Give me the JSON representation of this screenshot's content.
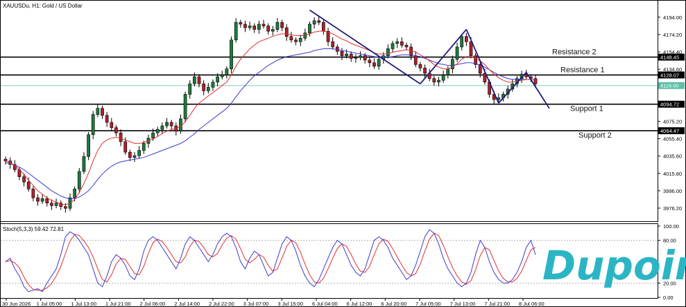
{
  "chart_data": {
    "type": "candlestick",
    "header": "XAUUSDu, H1:  Gold / US Dollar",
    "oscillator_label": "Stoch(5,3,3) 59.42 72.81",
    "price_ticks": [
      "4194.00",
      "4174.20",
      "4154.40",
      "4134.60",
      "4115.00",
      "4094.80",
      "4075.20",
      "4055.40",
      "4035.60",
      "4015.80",
      "3996.00",
      "3976.20"
    ],
    "stoch_ticks": [
      "100.00",
      "80.00",
      "20.00",
      "0.00"
    ],
    "time_labels": [
      "30 Jun 2026",
      "1 Jul 05:00",
      "1 Jul 13:00",
      "1 Jul 21:00",
      "2 Jul 06:00",
      "2 Jul 14:00",
      "2 Jul 22:00",
      "3 Jul 07:00",
      "3 Jul 15:00",
      "6 Jul 04:00",
      "6 Jul 12:00",
      "6 Jul 20:00",
      "7 Jul 05:00",
      "7 Jul 13:00",
      "7 Jul 21:00",
      "8 Jul 06:00"
    ],
    "levels": [
      {
        "name": "Resistance 2",
        "value": 4148.45,
        "tag": "4148.45"
      },
      {
        "name": "Resistance 1",
        "value": 4128.07,
        "tag": "4128.07"
      },
      {
        "name": "Support 1",
        "value": 4094.72,
        "tag": "4094.72"
      },
      {
        "name": "Support 2",
        "value": 4064.47,
        "tag": "4064.47"
      }
    ],
    "current_price": {
      "value": 4116.0,
      "tag": "4116.00"
    },
    "ylim": [
      3962,
      4212
    ],
    "stoch_ylim": [
      0,
      100
    ],
    "closes": [
      4030,
      4026,
      4020,
      4012,
      4006,
      3998,
      3988,
      3984,
      3987,
      3982,
      3979,
      3982,
      3978,
      3976,
      3988,
      3998,
      4018,
      4035,
      4060,
      4083,
      4090,
      4082,
      4074,
      4068,
      4062,
      4052,
      4040,
      4034,
      4036,
      4042,
      4050,
      4056,
      4062,
      4066,
      4070,
      4074,
      4070,
      4064,
      4078,
      4106,
      4118,
      4126,
      4118,
      4110,
      4114,
      4120,
      4126,
      4128,
      4135,
      4168,
      4188,
      4186,
      4182,
      4184,
      4180,
      4186,
      4184,
      4178,
      4180,
      4188,
      4182,
      4172,
      4168,
      4166,
      4170,
      4176,
      4186,
      4190,
      4188,
      4178,
      4166,
      4160,
      4155,
      4150,
      4152,
      4147,
      4148,
      4150,
      4145,
      4142,
      4138,
      4146,
      4150,
      4158,
      4164,
      4166,
      4162,
      4160,
      4150,
      4140,
      4136,
      4130,
      4124,
      4120,
      4122,
      4128,
      4135,
      4146,
      4160,
      4172,
      4166,
      4150,
      4140,
      4130,
      4120,
      4106,
      4100,
      4102,
      4106,
      4112,
      4118,
      4124,
      4129,
      4126,
      4124,
      4118
    ],
    "ma_fast": [
      4030,
      4028,
      4025,
      4020,
      4015,
      4008,
      4002,
      3996,
      3992,
      3988,
      3985,
      3983,
      3981,
      3980,
      3982,
      3986,
      3994,
      4004,
      4016,
      4030,
      4042,
      4050,
      4054,
      4056,
      4057,
      4056,
      4054,
      4052,
      4050,
      4050,
      4051,
      4053,
      4055,
      4058,
      4061,
      4064,
      4066,
      4067,
      4069,
      4075,
      4082,
      4090,
      4096,
      4100,
      4104,
      4108,
      4112,
      4116,
      4120,
      4128,
      4138,
      4146,
      4152,
      4158,
      4162,
      4166,
      4168,
      4170,
      4172,
      4174,
      4175,
      4175,
      4174,
      4173,
      4173,
      4173,
      4175,
      4177,
      4178,
      4178,
      4177,
      4175,
      4172,
      4169,
      4167,
      4164,
      4162,
      4160,
      4158,
      4156,
      4153,
      4152,
      4152,
      4152,
      4154,
      4155,
      4156,
      4157,
      4156,
      4154,
      4151,
      4148,
      4144,
      4140,
      4137,
      4135,
      4135,
      4137,
      4141,
      4146,
      4149,
      4149,
      4147,
      4144,
      4140,
      4134,
      4129,
      4125,
      4122,
      4120,
      4120,
      4121,
      4122,
      4123,
      4123,
      4122
    ],
    "ma_slow": [
      4028,
      4027,
      4025,
      4023,
      4020,
      4016,
      4012,
      4008,
      4004,
      4000,
      3996,
      3993,
      3990,
      3988,
      3987,
      3987,
      3989,
      3992,
      3996,
      4002,
      4009,
      4015,
      4020,
      4024,
      4027,
      4029,
      4030,
      4031,
      4032,
      4033,
      4034,
      4036,
      4038,
      4040,
      4042,
      4044,
      4046,
      4048,
      4050,
      4053,
      4057,
      4061,
      4066,
      4070,
      4074,
      4078,
      4082,
      4086,
      4090,
      4096,
      4103,
      4110,
      4116,
      4122,
      4127,
      4131,
      4135,
      4139,
      4142,
      4145,
      4147,
      4149,
      4150,
      4151,
      4152,
      4153,
      4154,
      4156,
      4157,
      4158,
      4158,
      4158,
      4157,
      4156,
      4155,
      4154,
      4153,
      4152,
      4151,
      4150,
      4149,
      4148,
      4148,
      4148,
      4149,
      4150,
      4151,
      4151,
      4151,
      4150,
      4149,
      4147,
      4145,
      4143,
      4141,
      4140,
      4139,
      4139,
      4140,
      4141,
      4142,
      4142,
      4141,
      4139,
      4137,
      4134,
      4131,
      4128,
      4126,
      4124,
      4123,
      4123,
      4123,
      4123,
      4123,
      4122
    ],
    "stoch_main": [
      50,
      55,
      40,
      30,
      15,
      8,
      10,
      12,
      8,
      20,
      30,
      40,
      60,
      85,
      92,
      88,
      80,
      70,
      60,
      40,
      20,
      15,
      30,
      50,
      60,
      55,
      45,
      30,
      25,
      40,
      65,
      80,
      85,
      80,
      70,
      60,
      50,
      40,
      55,
      75,
      85,
      80,
      70,
      60,
      50,
      60,
      75,
      85,
      90,
      85,
      70,
      50,
      40,
      55,
      65,
      60,
      45,
      30,
      35,
      55,
      75,
      85,
      80,
      65,
      45,
      30,
      20,
      15,
      25,
      40,
      55,
      70,
      80,
      75,
      60,
      45,
      35,
      30,
      40,
      60,
      80,
      85,
      80,
      70,
      55,
      45,
      35,
      25,
      30,
      45,
      65,
      85,
      95,
      90,
      75,
      55,
      40,
      30,
      20,
      15,
      20,
      35,
      60,
      80,
      70,
      50,
      35,
      25,
      20,
      20,
      25,
      35,
      50,
      70,
      80,
      60
    ]
  }
}
